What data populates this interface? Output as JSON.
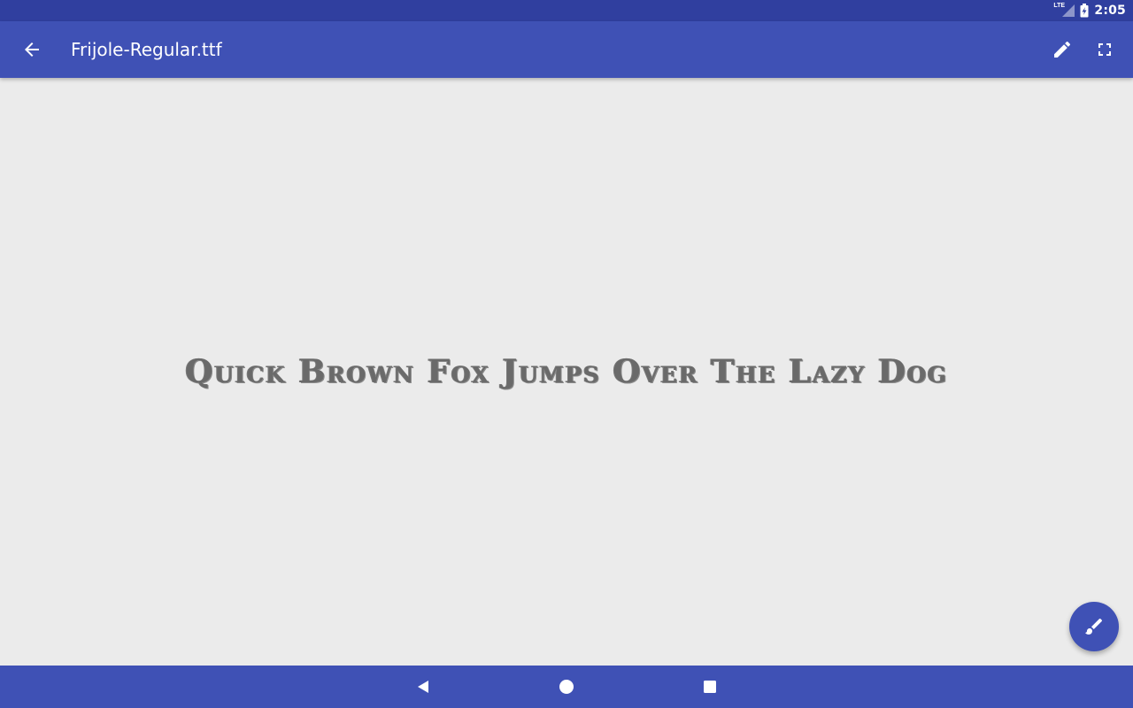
{
  "status_bar": {
    "network_label": "LTE",
    "time": "2:05",
    "icons": [
      "lte-signal-icon",
      "battery-charging-icon"
    ]
  },
  "app_bar": {
    "title": "Frijole-Regular.ttf",
    "icons": {
      "back": "arrow-back-icon",
      "edit": "pencil-icon",
      "fullscreen": "fullscreen-icon"
    }
  },
  "preview": {
    "sample_text": "Quick Brown Fox Jumps Over The Lazy Dog"
  },
  "fab": {
    "icon": "brush-icon"
  },
  "nav_bar": {
    "icons": [
      "nav-back-icon",
      "nav-home-icon",
      "nav-recents-icon"
    ]
  },
  "colors": {
    "primary": "#3f51b5",
    "primary_dark": "#303f9f",
    "background": "#ebebeb",
    "sample_text": "#6a6a6a",
    "on_primary": "#ffffff"
  }
}
